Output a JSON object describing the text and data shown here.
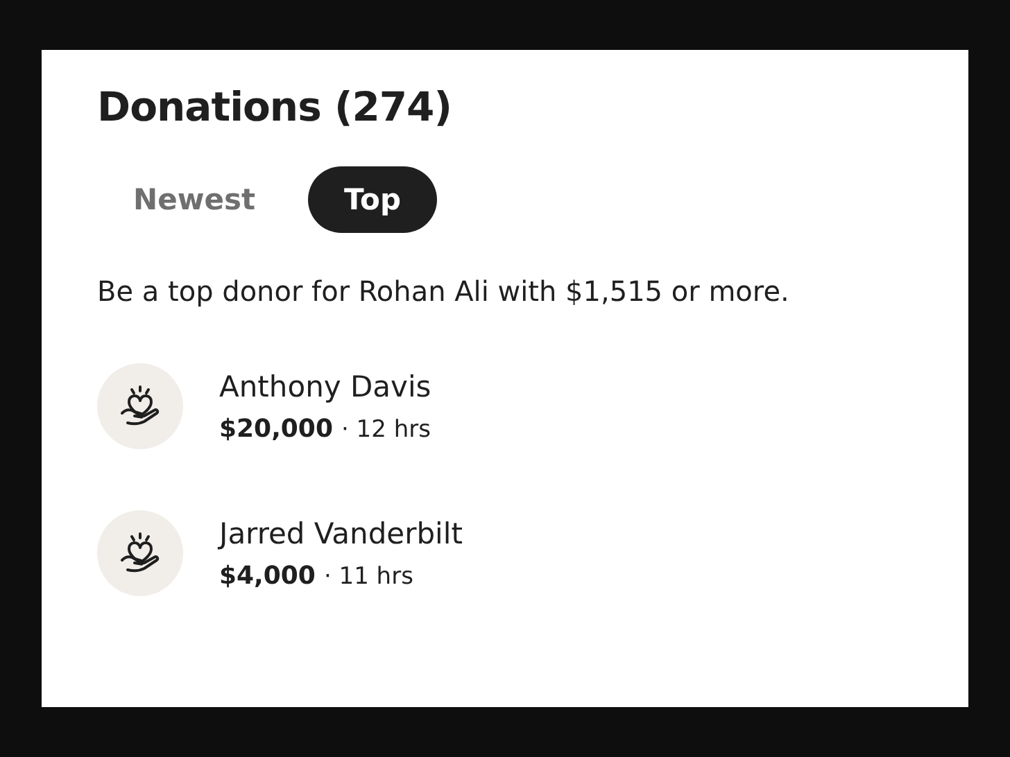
{
  "title": "Donations (274)",
  "tabs": [
    {
      "label": "Newest",
      "selected": false
    },
    {
      "label": "Top",
      "selected": true
    }
  ],
  "message": "Be a top donor for Rohan Ali with $1,515 or more.",
  "donations": [
    {
      "name": "Anthony Davis",
      "amount": "$20,000",
      "time": "· 12 hrs"
    },
    {
      "name": "Jarred Vanderbilt",
      "amount": "$4,000",
      "time": "· 11 hrs"
    }
  ]
}
